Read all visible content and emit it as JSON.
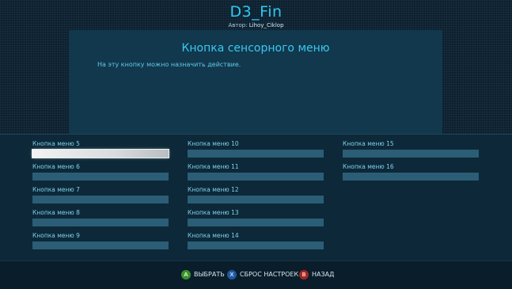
{
  "header": {
    "title": "D3_Fin",
    "author_prefix": "Автор:",
    "author_name": "Lihoy_Ciklop"
  },
  "panel": {
    "title": "Кнопка сенсорного меню",
    "description": "На эту кнопку можно назначить действие."
  },
  "menu_items": [
    {
      "label": "Кнопка меню 5",
      "selected": true
    },
    {
      "label": "Кнопка меню 6"
    },
    {
      "label": "Кнопка меню 7"
    },
    {
      "label": "Кнопка меню 8"
    },
    {
      "label": "Кнопка меню 9"
    },
    {
      "label": "Кнопка меню 10"
    },
    {
      "label": "Кнопка меню 11"
    },
    {
      "label": "Кнопка меню 12"
    },
    {
      "label": "Кнопка меню 13"
    },
    {
      "label": "Кнопка меню 14"
    },
    {
      "label": "Кнопка меню 15"
    },
    {
      "label": "Кнопка меню 16"
    }
  ],
  "footer": {
    "select": {
      "icon": "a-button-icon",
      "glyph": "A",
      "label": "ВЫБРАТЬ",
      "color": "#3d8f2e"
    },
    "reset": {
      "icon": "x-button-icon",
      "glyph": "X",
      "label": "СБРОС НАСТРОЕК",
      "color": "#21579c"
    },
    "back": {
      "icon": "b-button-icon",
      "glyph": "B",
      "label": "НАЗАД",
      "color": "#9b2a23"
    }
  }
}
